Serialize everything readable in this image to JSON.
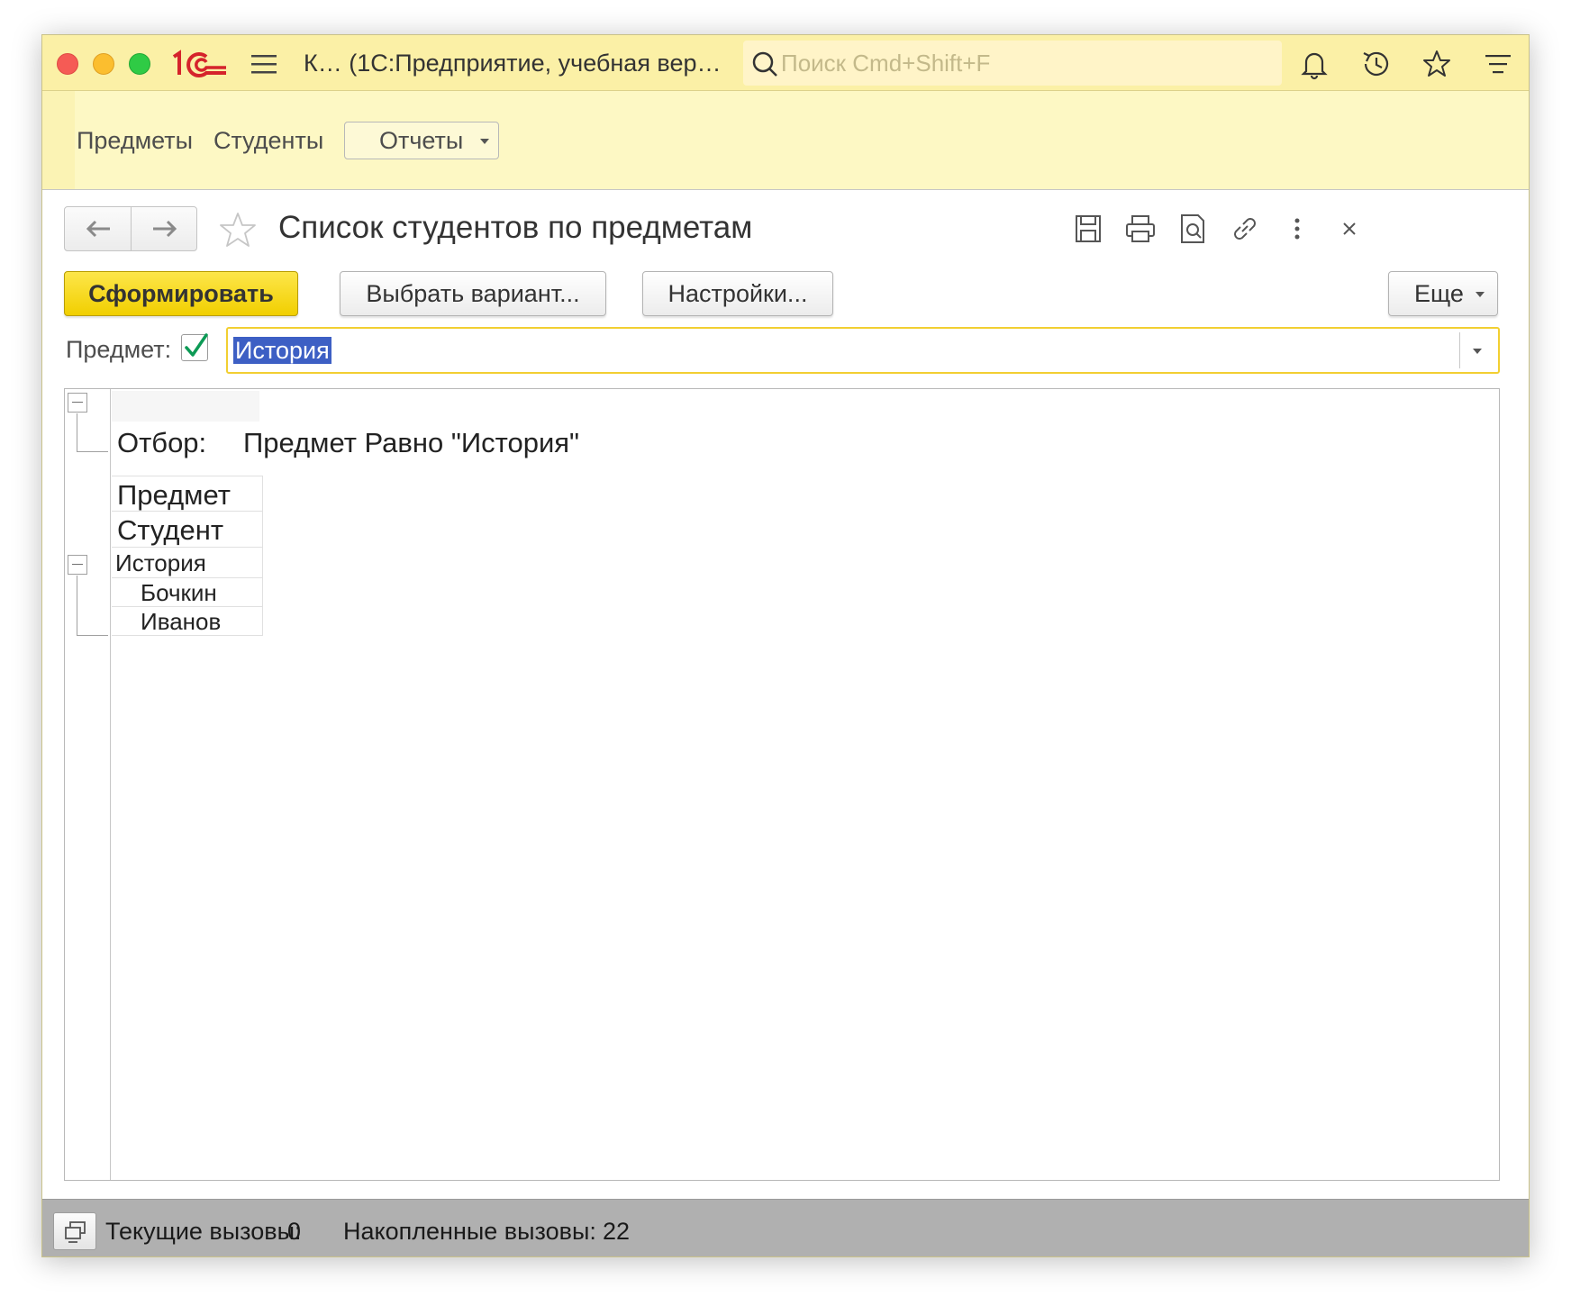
{
  "titlebar": {
    "app_title": "К… (1С:Предприятие, учебная вер…",
    "search_placeholder": "Поиск Cmd+Shift+F",
    "icons": [
      "bell-icon",
      "history-icon",
      "star-icon",
      "filter-menu-icon"
    ]
  },
  "sections": {
    "items": [
      {
        "label": "Предметы"
      },
      {
        "label": "Студенты"
      }
    ],
    "reports_dropdown": "Отчеты"
  },
  "form": {
    "title": "Список студентов по предметам",
    "header_icons": [
      "save-icon",
      "print-icon",
      "preview-icon",
      "link-icon",
      "more-vertical-icon",
      "close-icon"
    ]
  },
  "commands": {
    "generate": "Сформировать",
    "choose_variant": "Выбрать вариант...",
    "settings": "Настройки...",
    "more": "Еще"
  },
  "parameter": {
    "label": "Предмет:",
    "checked": true,
    "value": "История"
  },
  "report": {
    "filter_label": "Отбор:",
    "filter_value": "Предмет Равно \"История\"",
    "header_rows": [
      "Предмет",
      "Студент"
    ],
    "groups": [
      {
        "name": "История",
        "students": [
          "Бочкин",
          "Иванов"
        ]
      }
    ]
  },
  "status": {
    "current_calls_label": "Текущие вызовы:",
    "current_calls": "0",
    "accumulated_calls_label": "Накопленные вызовы:",
    "accumulated_calls": "22"
  },
  "colors": {
    "titlebar_bg": "#fbf0a6",
    "section_panel_bg": "#fdf8c4",
    "primary_button": "#f1cf00",
    "selection": "#3d5fc4",
    "checkmark": "#0c9a55",
    "status_bg": "#b0b0b0"
  }
}
